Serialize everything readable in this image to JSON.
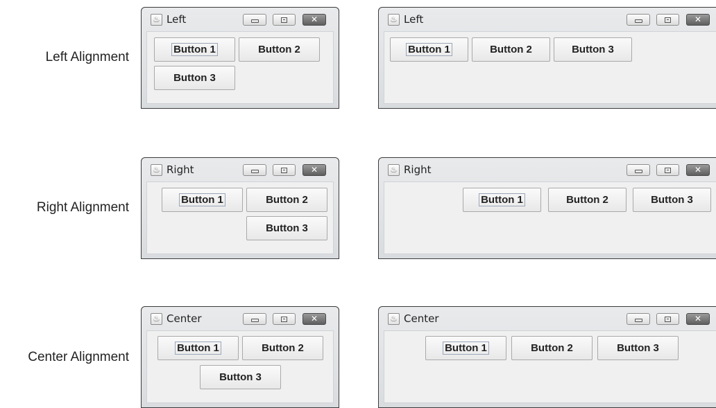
{
  "rows": [
    {
      "label": "Left Alignment",
      "small": {
        "title": "Left",
        "buttons": [
          "Button 1",
          "Button 2",
          "Button 3"
        ]
      },
      "large": {
        "title": "Left",
        "buttons": [
          "Button 1",
          "Button 2",
          "Button 3"
        ]
      }
    },
    {
      "label": "Right Alignment",
      "small": {
        "title": "Right",
        "buttons": [
          "Button 1",
          "Button 2",
          "Button 3"
        ]
      },
      "large": {
        "title": "Right",
        "buttons": [
          "Button 1",
          "Button 2",
          "Button 3"
        ]
      }
    },
    {
      "label": "Center Alignment",
      "small": {
        "title": "Center",
        "buttons": [
          "Button 1",
          "Button 2",
          "Button 3"
        ]
      },
      "large": {
        "title": "Center",
        "buttons": [
          "Button 1",
          "Button 2",
          "Button 3"
        ]
      }
    }
  ],
  "icons": {
    "app": "java-cup-icon",
    "minimize": "minimize-icon",
    "maximize": "maximize-icon",
    "close": "close-icon"
  }
}
